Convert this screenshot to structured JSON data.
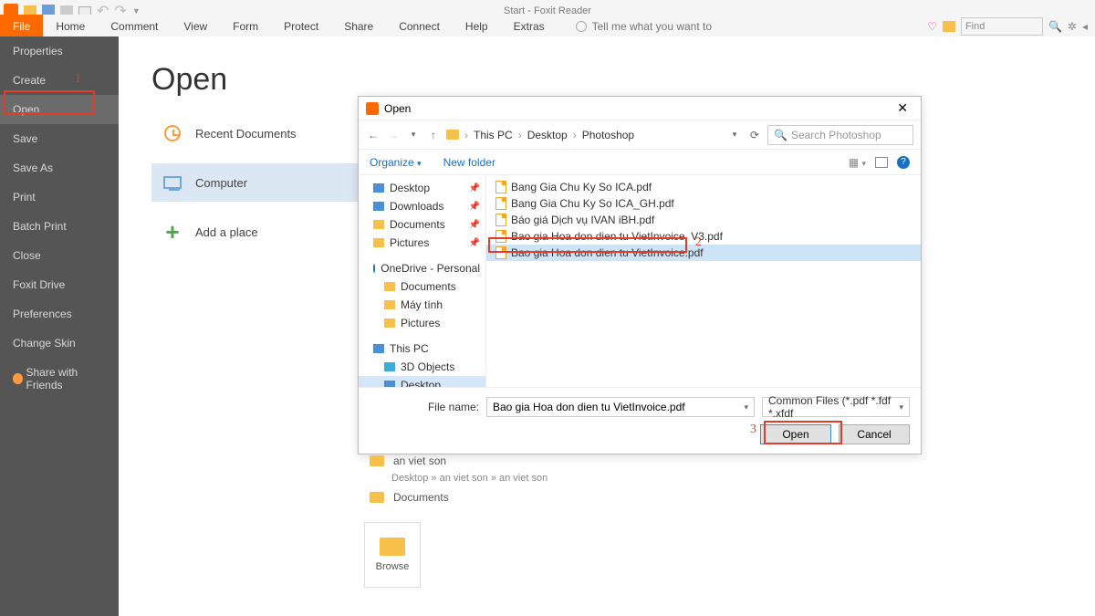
{
  "app": {
    "title": "Start - Foxit Reader"
  },
  "ribbon": {
    "file": "File",
    "tabs": [
      "Home",
      "Comment",
      "View",
      "Form",
      "Protect",
      "Share",
      "Connect",
      "Help",
      "Extras"
    ],
    "tellme_placeholder": "Tell me what you want to",
    "find": "Find"
  },
  "backstage": {
    "items": [
      "Properties",
      "Create",
      "Open",
      "Save",
      "Save As",
      "Print",
      "Batch Print",
      "Close",
      "Foxit Drive",
      "Preferences",
      "Change Skin",
      "Share with Friends"
    ],
    "activeIndex": 2
  },
  "openPage": {
    "title": "Open",
    "options": [
      "Recent Documents",
      "Computer",
      "Add a place"
    ]
  },
  "dialog": {
    "title": "Open",
    "breadcrumb": [
      "This PC",
      "Desktop",
      "Photoshop"
    ],
    "searchPlaceholder": "Search Photoshop",
    "organize": "Organize",
    "newFolder": "New folder",
    "tree": [
      {
        "label": "Desktop",
        "icon": "desktop",
        "pin": true
      },
      {
        "label": "Downloads",
        "icon": "download",
        "pin": true
      },
      {
        "label": "Documents",
        "icon": "folder",
        "pin": true
      },
      {
        "label": "Pictures",
        "icon": "pictures",
        "pin": true
      },
      {
        "label": "OneDrive - Personal",
        "icon": "onedrive",
        "gap": true
      },
      {
        "label": "Documents",
        "icon": "folder",
        "indent": true
      },
      {
        "label": "Máy tính",
        "icon": "folder",
        "indent": true
      },
      {
        "label": "Pictures",
        "icon": "folder",
        "indent": true
      },
      {
        "label": "This PC",
        "icon": "thispc",
        "gap": true
      },
      {
        "label": "3D Objects",
        "icon": "obj3d",
        "indent": true
      },
      {
        "label": "Desktop",
        "icon": "desktop",
        "indent": true,
        "selected": true
      }
    ],
    "files": [
      "Bang Gia Chu Ky So ICA.pdf",
      "Bang Gia Chu Ky So ICA_GH.pdf",
      "Báo giá Dịch vụ IVAN iBH.pdf",
      "Bao gia Hoa don dien tu VietInvoice. V3.pdf",
      "Bao gia Hoa don dien tu VietInvoice.pdf"
    ],
    "selectedFileIndex": 4,
    "fileNameLabel": "File name:",
    "fileName": "Bao gia Hoa don dien tu VietInvoice.pdf",
    "fileType": "Common Files (*.pdf *.fdf *.xfdf",
    "openBtn": "Open",
    "cancelBtn": "Cancel"
  },
  "recent": {
    "row1": "an viet son",
    "row1path": "Desktop » an viet son » an viet son",
    "row2": "Documents"
  },
  "browse": "Browse",
  "annotations": {
    "a1": "1",
    "a2": "2",
    "a3": "3"
  }
}
